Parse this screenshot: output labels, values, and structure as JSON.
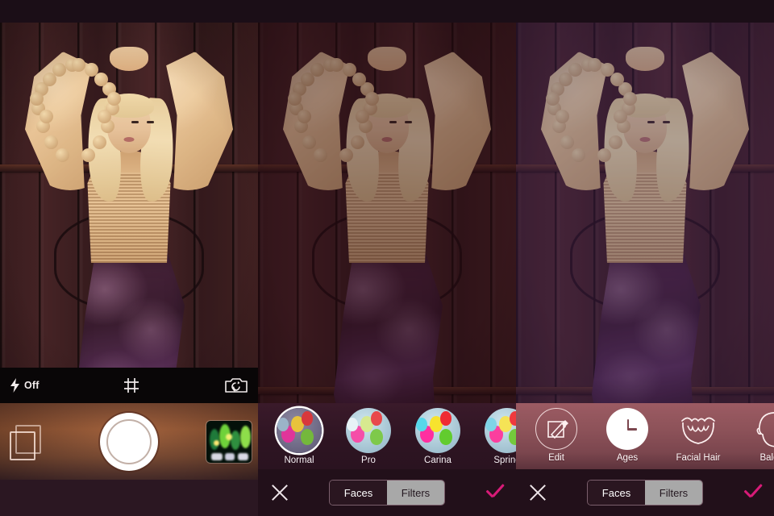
{
  "app": {
    "type": "mobile-photo-editor-comparison",
    "panel_count": 3
  },
  "colors": {
    "accent_magenta": "#d81b78",
    "camera_bar_bg": "#090607",
    "action_bar_bg": "#22101a",
    "segment_active_bg": "#2a1620",
    "segment_inactive_bg": "#a8a8a8",
    "face_strip_bg": "#8d5259",
    "filter_strip_bg": "#2e1422"
  },
  "photo": {
    "subject_description": "Woman with long blonde hair, arms raised above head, wearing cream chunky knit sweater and dark purple satin skirt, standing in front of dark wood plank wall",
    "grading": {
      "panel1": "warm brown",
      "panel2": "dark red",
      "panel3": "cool purple"
    }
  },
  "panel1": {
    "name": "camera-capture-screen",
    "toolbar": {
      "flash_icon": "lightning-bolt-icon",
      "flash_label": "Off",
      "grid_icon": "grid-icon",
      "flip_camera_icon": "camera-flip-icon"
    },
    "controls": {
      "aspect_ratio_icon": "overlapping-squares-icon",
      "shutter_label": "",
      "shutter_icon": "shutter-button",
      "gallery_thumbnail_icon": "gallery-thumbnail"
    }
  },
  "panel2": {
    "name": "filters-screen",
    "active_tab": "Filters",
    "filters": [
      {
        "label": "Normal",
        "selected": true,
        "preview_icon": "balloons-thumbnail"
      },
      {
        "label": "Pro",
        "selected": false,
        "preview_icon": "balloons-thumbnail"
      },
      {
        "label": "Carina",
        "selected": false,
        "preview_icon": "balloons-thumbnail"
      },
      {
        "label": "Spring",
        "selected": false,
        "preview_icon": "balloons-thumbnail"
      }
    ],
    "action_bar": {
      "cancel_icon": "close-x-icon",
      "tab_faces": "Faces",
      "tab_filters": "Filters",
      "confirm_icon": "checkmark-icon"
    }
  },
  "panel3": {
    "name": "face-effects-screen",
    "active_tab": "Faces",
    "effects": [
      {
        "label": "Edit",
        "icon": "pencil-square-icon",
        "selected": false
      },
      {
        "label": "Ages",
        "icon": "clock-icon",
        "selected": true
      },
      {
        "label": "Facial Hair",
        "icon": "beard-icon",
        "selected": false
      },
      {
        "label": "Bald",
        "icon": "bald-head-icon",
        "selected": false
      }
    ],
    "action_bar": {
      "cancel_icon": "close-x-icon",
      "tab_faces": "Faces",
      "tab_filters": "Filters",
      "confirm_icon": "checkmark-icon"
    }
  }
}
